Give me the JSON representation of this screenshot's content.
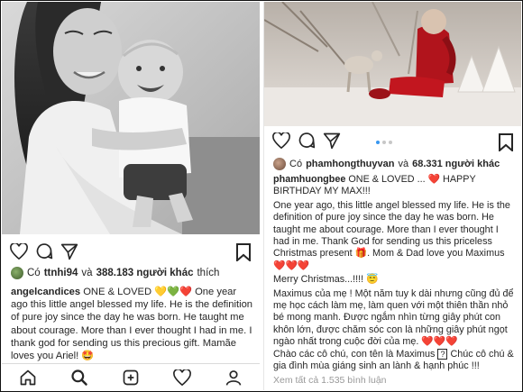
{
  "left_post": {
    "liked_by_prefix": "Có",
    "liked_by_user": "ttnhi94",
    "liked_by_and": "và",
    "liked_by_count": "388.183 người khác",
    "liked_by_suffix": "thích",
    "caption_user": "angelcandices",
    "caption_headline": "ONE & LOVED",
    "caption_hearts": "💛💚❤️",
    "caption_body": "One year ago this little angel blessed my life. He is the definition of pure joy since the day he was born. He taught me about courage. More than I ever thought I had in me. I thank god for sending us this precious gift. Mamãe loves you Ariel!",
    "caption_end_emoji": "🤩"
  },
  "right_post": {
    "liked_by_prefix": "Có",
    "liked_by_user": "phamhongthuyvan",
    "liked_by_and": "và",
    "liked_by_count": "68.331 người khác",
    "caption_user": "phamhuongbee",
    "caption_headline": "ONE & LOVED ...",
    "caption_heart": "❤️",
    "caption_headline2": "HAPPY BIRTHDAY MY MAX!!!",
    "caption_p1": "One year ago, this little angel blessed my life. He is the definition of pure joy since the day he was born. He taught me about courage. More than I ever thought I had in me. Thank God for sending us this priceless Christmas present",
    "caption_p1_emoji": "🎁",
    "caption_p1_tail": ". Mom & Dad love you Maximus",
    "caption_p1_hearts": "❤️❤️❤️",
    "caption_p2": "Merry Christmas...!!!!",
    "caption_p2_emoji": "😇",
    "caption_p3": "Maximus của mẹ ! Một năm tuy k dài nhưng cũng đủ để mẹ học cách làm mẹ, làm quen với một thiên thần nhỏ bé mong manh. Được ngắm nhìn từng giây phút con khôn lớn, được chăm sóc con là những giây phút ngọt ngào nhất trong cuộc đời của mẹ.",
    "caption_p3_hearts": "❤️❤️❤️",
    "caption_p4a": "Chào các cô chú, con tên là Maximus",
    "caption_p4_q": "?",
    "caption_p4b": "Chúc cô chú & gia đình mùa giáng sinh an lành & hạnh phúc !!!",
    "view_comments": "Xem tất cả 1.535 bình luận"
  },
  "icons": {
    "like": "heart-outline-icon",
    "comment": "comment-bubble-icon",
    "share": "paper-plane-icon",
    "save": "bookmark-icon",
    "home": "home-icon",
    "search": "search-icon",
    "new_post": "plus-square-icon",
    "activity": "heart-outline-icon",
    "profile": "person-icon"
  },
  "colors": {
    "text": "#262626",
    "muted": "#999999",
    "link_blue": "#3897f0",
    "heart_red": "#e0245e"
  }
}
